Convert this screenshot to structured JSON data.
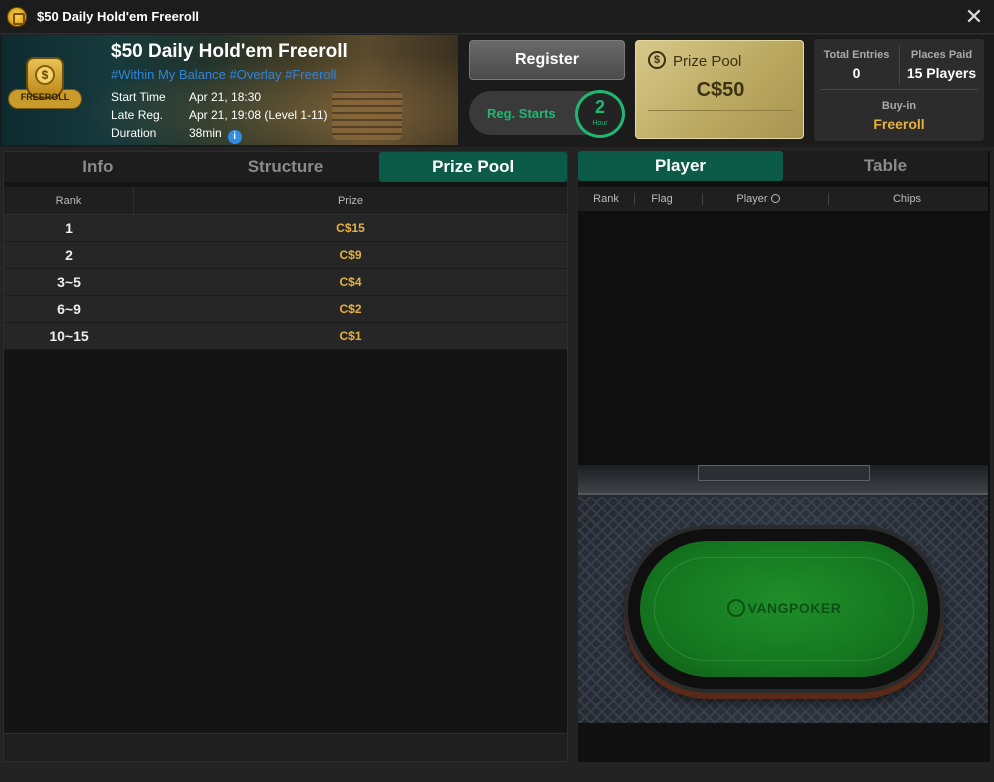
{
  "window": {
    "title": "$50 Daily Hold'em Freeroll",
    "close": "✕"
  },
  "banner": {
    "badge_label": "FREEROLL",
    "badge_coin": "$",
    "name": "$50 Daily Hold'em Freeroll",
    "tags": "#Within My Balance #Overlay #Freeroll",
    "start_time_label": "Start Time",
    "start_time_value": "Apr 21, 18:30",
    "late_reg_label": "Late Reg.",
    "late_reg_value": "Apr 21, 19:08 (Level 1-11)",
    "duration_label": "Duration",
    "duration_value": "38min",
    "duration_info": "i"
  },
  "actions": {
    "register_label": "Register",
    "reg_starts_label": "Reg. Starts",
    "reg_starts_value": "2",
    "reg_starts_unit": "Hour"
  },
  "prize_pool_card": {
    "icon": "$",
    "label": "Prize Pool",
    "value": "C$50"
  },
  "stats": {
    "total_entries_label": "Total Entries",
    "total_entries_value": "0",
    "places_paid_label": "Places Paid",
    "places_paid_value": "15 Players",
    "buyin_label": "Buy-in",
    "buyin_value": "Freeroll"
  },
  "left_tabs": [
    {
      "label": "Info",
      "active": false
    },
    {
      "label": "Structure",
      "active": false
    },
    {
      "label": "Prize Pool",
      "active": true
    }
  ],
  "prize_table": {
    "columns": [
      "Rank",
      "Prize"
    ],
    "rows": [
      {
        "rank": "1",
        "prize": "C$15"
      },
      {
        "rank": "2",
        "prize": "C$9"
      },
      {
        "rank": "3~5",
        "prize": "C$4"
      },
      {
        "rank": "6~9",
        "prize": "C$2"
      },
      {
        "rank": "10~15",
        "prize": "C$1"
      }
    ]
  },
  "right_tabs": [
    {
      "label": "Player",
      "active": true
    },
    {
      "label": "Table",
      "active": false
    }
  ],
  "player_table": {
    "columns": [
      "Rank",
      "Flag",
      "Player",
      "Chips"
    ]
  },
  "table_brand": "VANGPOKER",
  "colors": {
    "accent_green": "#0c5b48",
    "gold": "#e5b13e",
    "reg_green": "#1fb873"
  }
}
